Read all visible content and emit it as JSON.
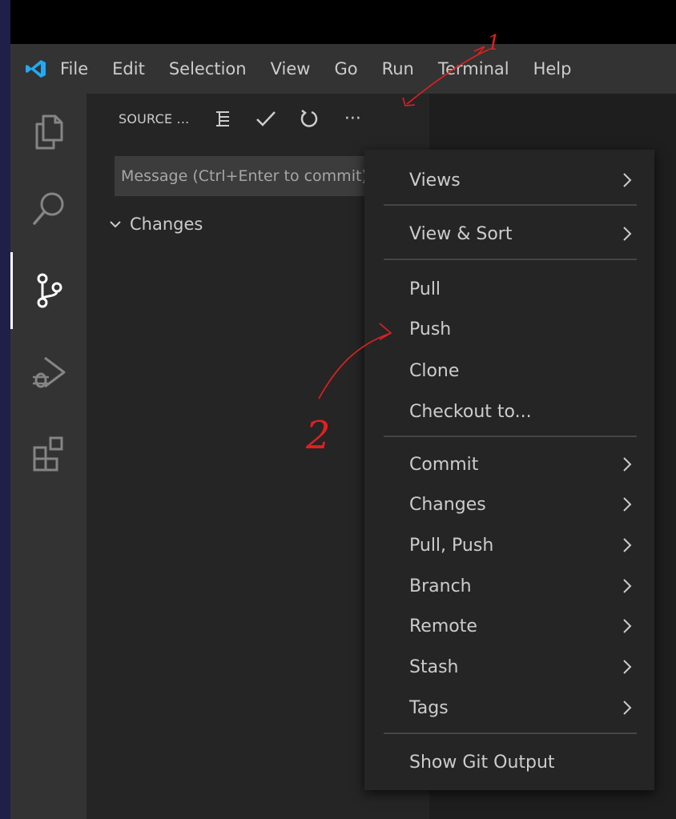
{
  "menubar": {
    "items": [
      "File",
      "Edit",
      "Selection",
      "View",
      "Go",
      "Run",
      "Terminal",
      "Help"
    ]
  },
  "activitybar": {
    "items": [
      {
        "name": "explorer-icon",
        "active": false
      },
      {
        "name": "search-icon",
        "active": false
      },
      {
        "name": "source-control-icon",
        "active": true
      },
      {
        "name": "run-debug-icon",
        "active": false
      },
      {
        "name": "extensions-icon",
        "active": false
      }
    ]
  },
  "sidebar": {
    "title": "SOURCE ...",
    "actions": {
      "view_as_tree": "list-tree-icon",
      "commit": "check-icon",
      "refresh": "refresh-icon",
      "more": "···"
    },
    "message_placeholder": "Message (Ctrl+Enter to commit)",
    "changes_label": "Changes"
  },
  "context_menu": {
    "items": [
      {
        "label": "Views",
        "submenu": true
      },
      {
        "label": "View & Sort",
        "submenu": true
      },
      {
        "label": "Pull",
        "submenu": false
      },
      {
        "label": "Push",
        "submenu": false
      },
      {
        "label": "Clone",
        "submenu": false
      },
      {
        "label": "Checkout to...",
        "submenu": false
      },
      {
        "label": "Commit",
        "submenu": true
      },
      {
        "label": "Changes",
        "submenu": true
      },
      {
        "label": "Pull, Push",
        "submenu": true
      },
      {
        "label": "Branch",
        "submenu": true
      },
      {
        "label": "Remote",
        "submenu": true
      },
      {
        "label": "Stash",
        "submenu": true
      },
      {
        "label": "Tags",
        "submenu": true
      },
      {
        "label": "Show Git Output",
        "submenu": false
      }
    ]
  },
  "annotations": {
    "first": "1",
    "second": "2",
    "color": "#e02020"
  },
  "colors": {
    "accent": "#007acc",
    "menubar_bg": "#333333",
    "sidebar_bg": "#252526",
    "editor_bg": "#1e1e1e"
  }
}
